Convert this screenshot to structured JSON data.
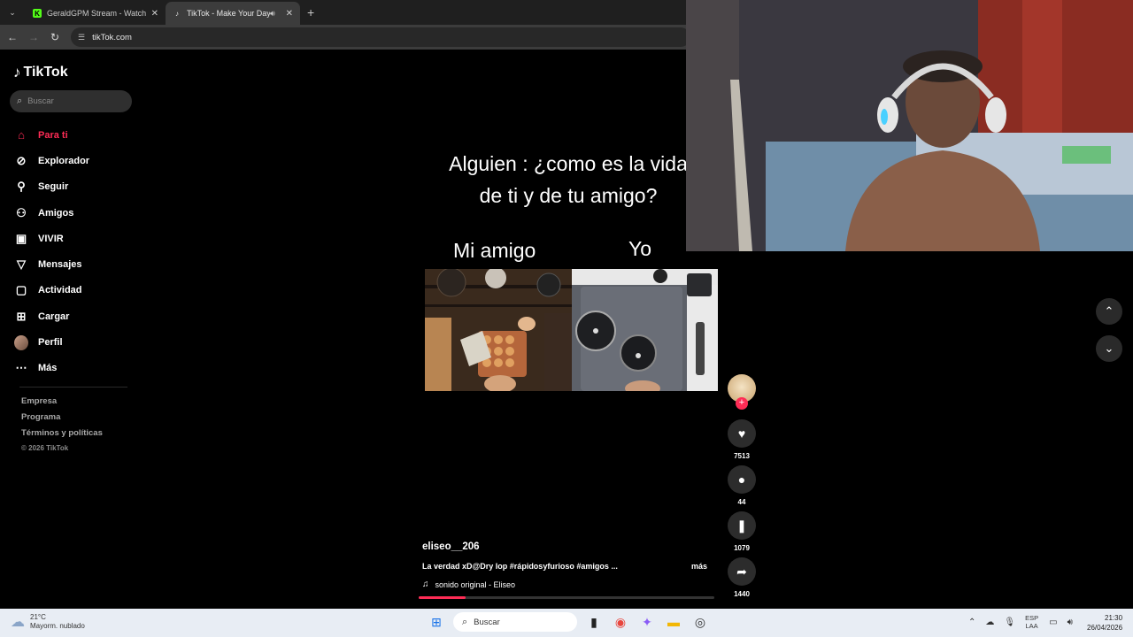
{
  "browser": {
    "tabs": [
      {
        "title": "GeraldGPM Stream - Watch Live",
        "favicon": "K",
        "favicon_color": "#53fc18"
      },
      {
        "title": "TikTok - Make Your Day",
        "favicon": "♪"
      }
    ],
    "url": "tikTok.com"
  },
  "tiktok": {
    "logo": "TikTok",
    "search_placeholder": "Buscar",
    "menu": [
      {
        "label": "Para ti",
        "icon": "home-icon"
      },
      {
        "label": "Explorador",
        "icon": "compass-icon"
      },
      {
        "label": "Seguir",
        "icon": "user-follow-icon"
      },
      {
        "label": "Amigos",
        "icon": "friends-icon"
      },
      {
        "label": "VIVIR",
        "icon": "live-tv-icon"
      },
      {
        "label": "Mensajes",
        "icon": "send-icon"
      },
      {
        "label": "Actividad",
        "icon": "activity-icon"
      },
      {
        "label": "Cargar",
        "icon": "upload-icon"
      },
      {
        "label": "Perfil",
        "icon": "profile-avatar"
      },
      {
        "label": "Más",
        "icon": "more-icon"
      }
    ],
    "footer": {
      "empresa": "Empresa",
      "programa": "Programa",
      "terminos": "Términos y políticas",
      "copyright": "© 2026 TikTok"
    },
    "video": {
      "caption_line1": "Alguien : ¿como es la vida",
      "caption_line2": "de ti y de tu amigo?",
      "label_left": "Mi amigo",
      "label_right": "Yo",
      "username": "eliseo__206",
      "description": "La verdad xD@Dry lop #rápidosyfurioso #amigos ...",
      "more": "más",
      "sound": "sonido original - Eliseo",
      "progress": 0.16
    },
    "actions": {
      "likes": "7513",
      "comments": "44",
      "saves": "1079",
      "shares": "1440"
    },
    "accent": "#fe2c55"
  },
  "taskbar": {
    "weather_temp": "21°C",
    "weather_desc": "Mayorm. nublado",
    "search": "Buscar",
    "lang1": "ESP",
    "lang2": "LAA",
    "time": "21:30",
    "date": "26/04/2026"
  }
}
